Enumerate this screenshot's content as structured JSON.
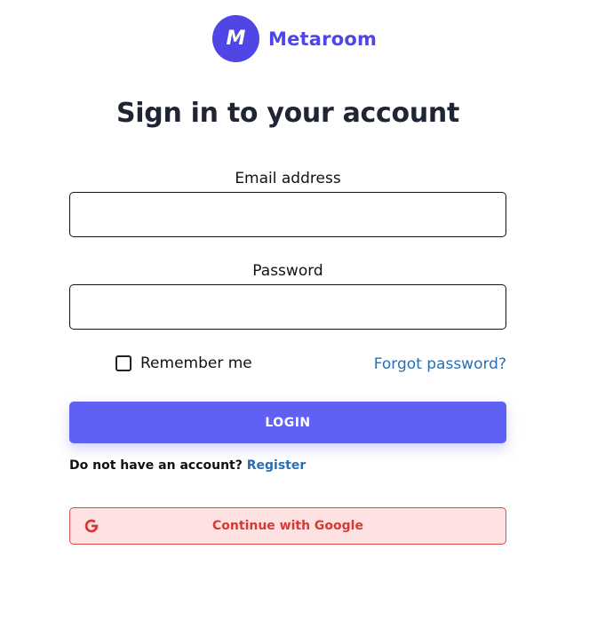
{
  "brand": {
    "logo_letter": "M",
    "name": "Metaroom",
    "color": "#4f46e5"
  },
  "title": "Sign in to your account",
  "email": {
    "label": "Email address",
    "value": "",
    "placeholder": ""
  },
  "password": {
    "label": "Password",
    "value": "",
    "placeholder": ""
  },
  "remember": {
    "label": "Remember me",
    "checked": false
  },
  "forgot_label": "Forgot password?",
  "login": {
    "label": "LOGIN",
    "color": "#6160f5"
  },
  "register": {
    "prompt": "Do not have an account?",
    "link_label": "Register"
  },
  "google": {
    "label": "Continue with Google",
    "icon": "google-g-icon",
    "color": "#d63a36",
    "background": "#fee2e2"
  },
  "link_color": "#2a6db5"
}
